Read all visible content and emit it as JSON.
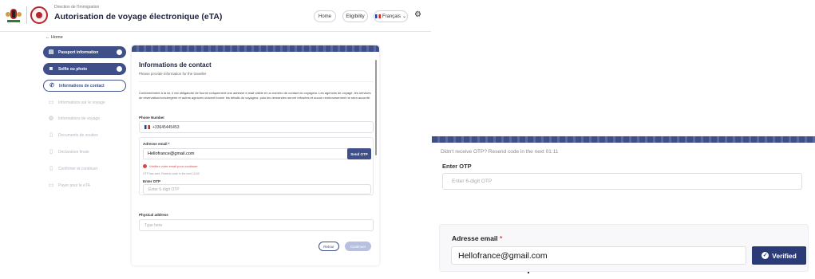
{
  "header": {
    "department": "Direction de l'Immigration",
    "title": "Autorisation de voyage électronique (eTA)",
    "nav": {
      "home": "Home",
      "eligibility": "Eligibility",
      "language": "Français"
    }
  },
  "back_label": "Home",
  "sidebar": {
    "steps": [
      {
        "label": "Passport information",
        "state": "done"
      },
      {
        "label": "Selfie ou photo",
        "state": "done"
      },
      {
        "label": "Informations de contact",
        "state": "active"
      },
      {
        "label": "Informations sur le voyage",
        "state": "todo"
      },
      {
        "label": "Informations de voyage",
        "state": "todo"
      },
      {
        "label": "Documents de soutien",
        "state": "todo"
      },
      {
        "label": "Déclaration finale",
        "state": "todo"
      },
      {
        "label": "Confirmer et continuer",
        "state": "todo"
      },
      {
        "label": "Payer pour le eTA",
        "state": "todo"
      }
    ]
  },
  "form": {
    "title": "Informations de contact",
    "subtitle": "Please provide information for the traveller",
    "paragraph": "Conformément à la loi, il est obligatoire de fournir uniquement une adresse e-mail valide et un numéro de contact du voyageur. Les agences de voyage, les services de réservation/conciergerie et autres agences doivent fournir les détails du voyageur, puis les demandes seront refusées et aucun remboursement ne sera accordé.",
    "phone_label": "Phone Number",
    "phone_value": "+33645445453",
    "email_label": "Adresse email *",
    "email_value": "Hellofrance@gmail.com",
    "send_otp": "Send OTP",
    "verify_error": "Vérifiez votre email pour continuer",
    "otp_info": "OTP has sent. Resend code in the next 10:00",
    "otp_label": "Enter OTP",
    "otp_placeholder": "Enter 6-digit OTP",
    "address_label": "Physical address",
    "address_placeholder": "Type here",
    "back_button": "Retour",
    "continue_button": "Continuer"
  },
  "zoom_otp": {
    "resend": "Didn't receive OTP? Resend code in the next 01:11",
    "label": "Enter OTP",
    "placeholder": "Enter 6-digit OTP"
  },
  "zoom_email": {
    "label": "Adresse email",
    "required": "*",
    "value": "Hellofrance@gmail.com",
    "verified": "Verified"
  },
  "colors": {
    "primary": "#3e4f8a",
    "error": "#d04a4a",
    "verified": "#2a3b78"
  }
}
